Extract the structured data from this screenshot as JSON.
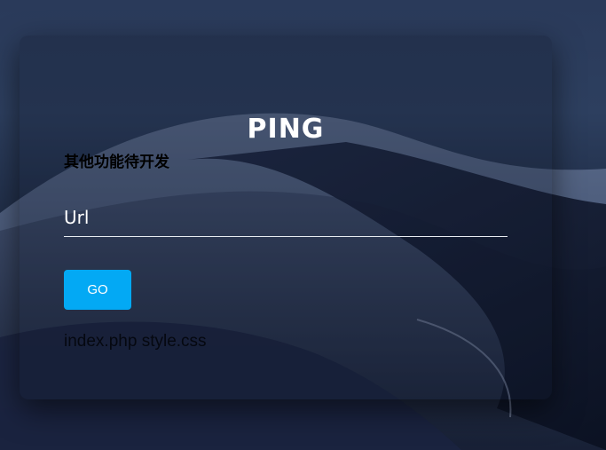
{
  "login_box": {
    "title": "PING",
    "subtitle": "其他功能待开发",
    "url_field": {
      "placeholder": "Url",
      "value": ""
    },
    "go_button_label": "GO",
    "file_links": [
      "index.php",
      "style.css"
    ]
  },
  "colors": {
    "accent": "#03a9f4",
    "text_light": "#ffffff",
    "text_dark": "#000000"
  }
}
